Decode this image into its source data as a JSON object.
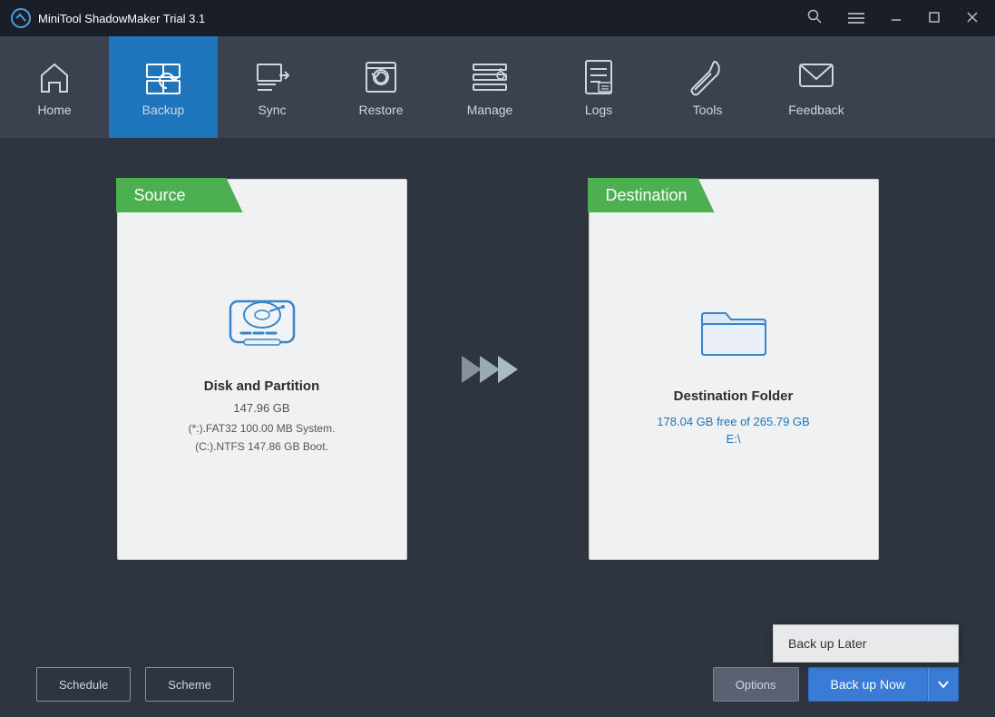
{
  "titlebar": {
    "title": "MiniTool ShadowMaker Trial 3.1"
  },
  "navbar": {
    "items": [
      {
        "id": "home",
        "label": "Home",
        "active": false
      },
      {
        "id": "backup",
        "label": "Backup",
        "active": true
      },
      {
        "id": "sync",
        "label": "Sync",
        "active": false
      },
      {
        "id": "restore",
        "label": "Restore",
        "active": false
      },
      {
        "id": "manage",
        "label": "Manage",
        "active": false
      },
      {
        "id": "logs",
        "label": "Logs",
        "active": false
      },
      {
        "id": "tools",
        "label": "Tools",
        "active": false
      },
      {
        "id": "feedback",
        "label": "Feedback",
        "active": false
      }
    ]
  },
  "source": {
    "header": "Source",
    "title": "Disk and Partition",
    "size": "147.96 GB",
    "desc_line1": "(*:).FAT32 100.00 MB System.",
    "desc_line2": "(C:).NTFS 147.86 GB Boot."
  },
  "destination": {
    "header": "Destination",
    "title": "Destination Folder",
    "free_space": "178.04 GB free of 265.79 GB",
    "path": "E:\\"
  },
  "bottombar": {
    "schedule_label": "Schedule",
    "scheme_label": "Scheme",
    "options_label": "Options",
    "backup_now_label": "Back up Now",
    "backup_later_label": "Back up Later"
  }
}
